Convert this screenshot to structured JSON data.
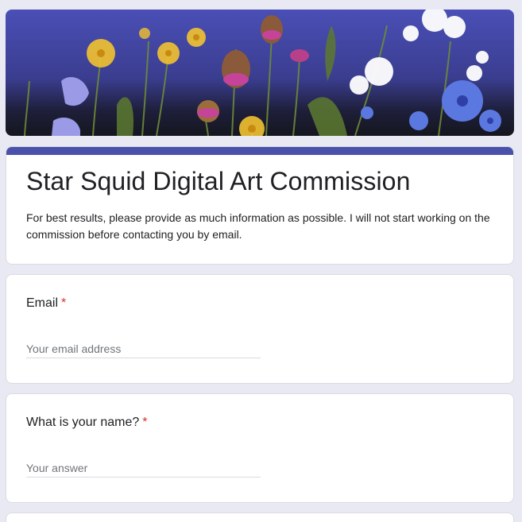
{
  "form": {
    "title": "Star Squid Digital Art Commission",
    "description": "For best results, please provide as much information as possible. I will not start working on the commission before contacting you by email.",
    "accent_color": "#4a51ab",
    "required_marker": "*"
  },
  "questions": [
    {
      "label": "Email",
      "placeholder": "Your email address",
      "value": "",
      "required": true
    },
    {
      "label": "What is your name?",
      "placeholder": "Your answer",
      "value": "",
      "required": true
    }
  ],
  "banner": {
    "icon": "flower-illustration-banner"
  }
}
